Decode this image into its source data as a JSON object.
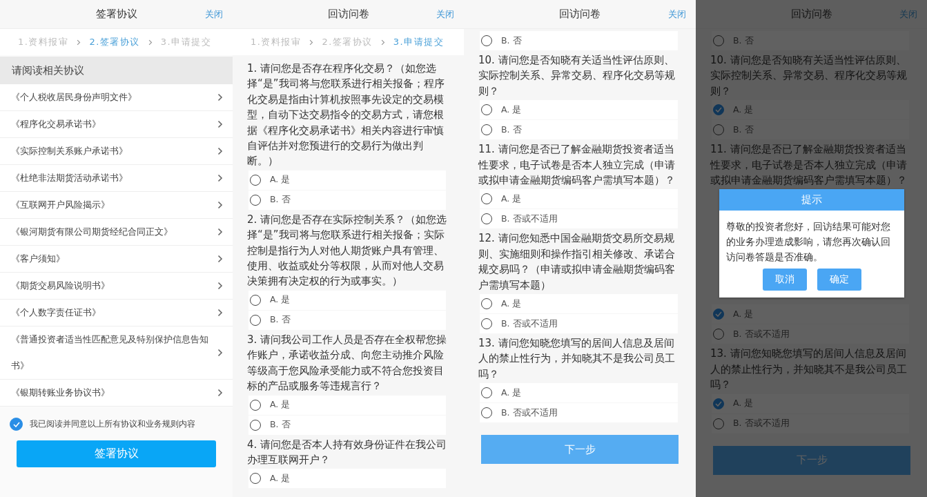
{
  "panels": [
    {
      "kind": "agreement",
      "title": "签署协议",
      "close": "关闭",
      "steps": [
        {
          "label": "1.资料报审",
          "selected": false
        },
        {
          "label": "2.签署协议",
          "selected": true
        },
        {
          "label": "3.申请提交",
          "selected": false
        }
      ],
      "section": "请阅读相关协议",
      "items": [
        "《个人税收居民身份声明文件》",
        "《程序化交易承诺书》",
        "《实际控制关系账户承诺书》",
        "《杜绝非法期货活动承诺书》",
        "《互联网开户风险揭示》",
        "《银河期货有限公司期货经纪合同正文》",
        "《客户须知》",
        "《期货交易风险说明书》",
        "《个人数字责任证书》",
        "《普通投资者适当性匹配意见及特别保护信息告知书》",
        "《银期转账业务协议书》"
      ],
      "agree": {
        "label": "我已阅读并同意以上所有协议和业务规则内容",
        "checked": true
      },
      "button": "签署协议"
    },
    {
      "kind": "survey",
      "title": "回访问卷",
      "close": "关闭",
      "steps": [
        {
          "label": "1.资料报审",
          "selected": false
        },
        {
          "label": "2.签署协议",
          "selected": false
        },
        {
          "label": "3.申请提交",
          "selected": true
        }
      ],
      "blocks": [
        {
          "kind": "question",
          "text": "1. 请问您是否存在程序化交易？（如您选择“是”我司将与您联系进行相关报备；程序化交易是指由计算机按照事先设定的交易模型，自动下达交易指令的交易方式，请您根据《程序化交易承诺书》相关内容进行审慎自评估并对您预进行的交易行为做出判断。）",
          "options": [
            {
              "label": "A. 是",
              "selected": false
            },
            {
              "label": "B. 否",
              "selected": false
            }
          ]
        },
        {
          "kind": "question",
          "text": "2. 请问您是否存在实际控制关系？（如您选择“是”我司将与您联系进行相关报备；实际控制是指行为人对他人期货账户具有管理、使用、收益或处分等权限，从而对他人交易决策拥有决定权的行为或事实。）",
          "options": [
            {
              "label": "A. 是",
              "selected": false
            },
            {
              "label": "B. 否",
              "selected": false
            }
          ]
        },
        {
          "kind": "question",
          "text": "3. 请问我公司工作人员是否存在全权帮您操作账户，承诺收益分成、向您主动推介风险等级高于您风险承受能力或不符合您投资目标的产品或服务等违规言行？",
          "options": [
            {
              "label": "A. 是",
              "selected": false
            },
            {
              "label": "B. 否",
              "selected": false
            }
          ]
        },
        {
          "kind": "question",
          "text": "4. 请问您是否本人持有效身份证件在我公司办理互联网开户？",
          "options": [
            {
              "label": "A. 是",
              "selected": false
            }
          ]
        }
      ]
    },
    {
      "kind": "survey",
      "title": "回访问卷",
      "close": "关闭",
      "blocks": [
        {
          "kind": "options",
          "options": [
            {
              "label": "B. 否",
              "selected": false
            }
          ]
        },
        {
          "kind": "question",
          "text": "10. 请问您是否知晓有关适当性评估原则、实际控制关系、异常交易、程序化交易等规则？",
          "options": [
            {
              "label": "A. 是",
              "selected": false
            },
            {
              "label": "B. 否",
              "selected": false
            }
          ]
        },
        {
          "kind": "question",
          "text": "11. 请问您是否已了解金融期货投资者适当性要求，电子试卷是否本人独立完成（申请或拟申请金融期货编码客户需填写本题）？",
          "options": [
            {
              "label": "A. 是",
              "selected": false
            },
            {
              "label": "B. 否或不适用",
              "selected": false
            }
          ]
        },
        {
          "kind": "question",
          "text": "12. 请问您知悉中国金融期货交易所交易规则、实施细则和操作指引相关修改、承诺合规交易吗？（申请或拟申请金融期货编码客户需填写本题）",
          "options": [
            {
              "label": "A. 是",
              "selected": false
            },
            {
              "label": "B. 否或不适用",
              "selected": false
            }
          ]
        },
        {
          "kind": "question",
          "text": "13. 请问您知晓您填写的居间人信息及居间人的禁止性行为，并知晓其不是我公司员工吗？",
          "options": [
            {
              "label": "A. 是",
              "selected": false
            },
            {
              "label": "B. 否或不适用",
              "selected": false
            }
          ]
        }
      ],
      "button": "下一步"
    },
    {
      "kind": "survey",
      "title": "回访问卷",
      "close": "关闭",
      "dimmed": true,
      "blocks": [
        {
          "kind": "options",
          "options": [
            {
              "label": "B. 否",
              "selected": false
            }
          ]
        },
        {
          "kind": "question",
          "text": "10. 请问您是否知晓有关适当性评估原则、实际控制关系、异常交易、程序化交易等规则？",
          "options": [
            {
              "label": "A. 是",
              "selected": true
            },
            {
              "label": "B. 否",
              "selected": false
            }
          ]
        },
        {
          "kind": "question",
          "text": "11. 请问您是否已了解金融期货投资者适当性要求，电子试卷是否本人独立完成（申请或拟申请金融期货编码客户需填写本题）？"
        },
        {
          "kind": "dialog",
          "title": "提示",
          "message": "尊敬的投资者您好，回访结果可能对您的业务办理造成影响，请您再次确认回访问卷答题是否准确。",
          "buttons": [
            "取消",
            "确定"
          ]
        },
        {
          "kind": "options",
          "options": [
            {
              "label": "A. 是",
              "selected": true
            },
            {
              "label": "B. 否或不适用",
              "selected": false
            }
          ]
        },
        {
          "kind": "question",
          "text": "13. 请问您知晓您填写的居间人信息及居间人的禁止性行为，并知晓其不是我公司员工吗？",
          "options": [
            {
              "label": "A. 是",
              "selected": true
            },
            {
              "label": "B. 否或不适用",
              "selected": false
            }
          ]
        }
      ],
      "button": "下一步"
    }
  ]
}
